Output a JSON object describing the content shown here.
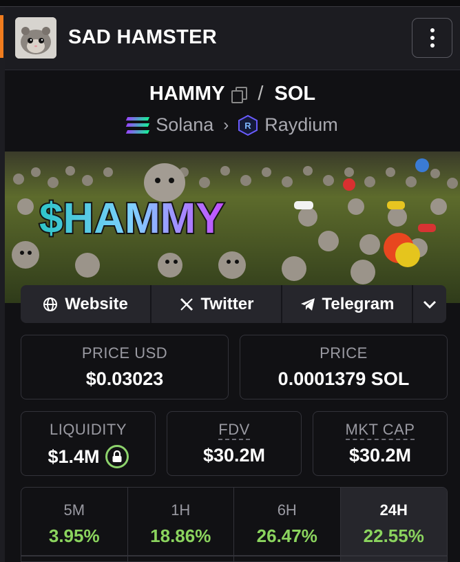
{
  "header": {
    "title": "SAD HAMSTER",
    "avatar": "hamster-avatar",
    "menu_icon": "kebab-menu-icon"
  },
  "pair": {
    "base": "HAMMY",
    "separator": "/",
    "quote": "SOL",
    "chain": "Solana",
    "chevron": "›",
    "dex": "Raydium"
  },
  "banner": {
    "text": "$HAMMY",
    "image": "hamster-crowd-banner"
  },
  "links": {
    "website": "Website",
    "twitter": "Twitter",
    "telegram": "Telegram"
  },
  "stats": {
    "price_usd": {
      "label": "PRICE USD",
      "value": "$0.03023"
    },
    "price": {
      "label": "PRICE",
      "value": "0.0001379 SOL"
    },
    "liquidity": {
      "label": "LIQUIDITY",
      "value": "$1.4M"
    },
    "fdv": {
      "label": "FDV",
      "value": "$30.2M"
    },
    "mkt_cap": {
      "label": "MKT CAP",
      "value": "$30.2M"
    }
  },
  "timeframes": [
    {
      "label": "5M",
      "value": "3.95%"
    },
    {
      "label": "1H",
      "value": "18.86%"
    },
    {
      "label": "6H",
      "value": "26.47%"
    },
    {
      "label": "24H",
      "value": "22.55%"
    }
  ],
  "colors": {
    "accent": "#f07c1e",
    "positive": "#8bd45e",
    "lock": "#8dd36c",
    "card_border": "#33333a"
  }
}
